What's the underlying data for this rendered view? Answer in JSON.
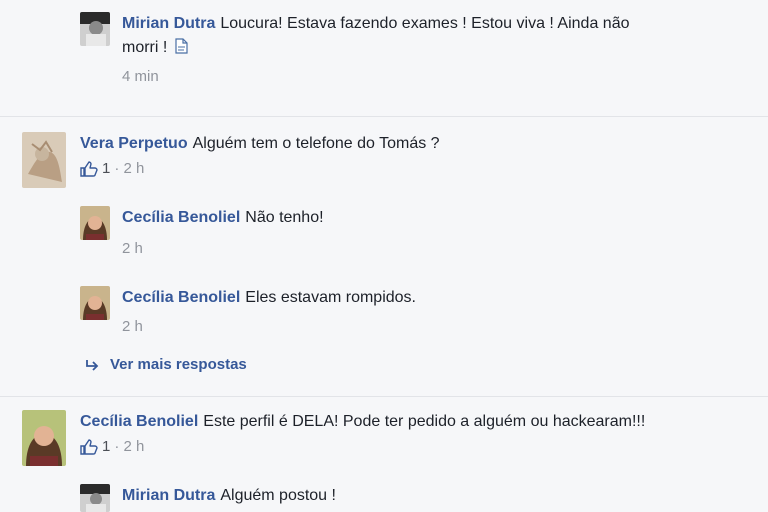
{
  "comments": [
    {
      "author": "Mirian Dutra",
      "text": "Loucura! Estava fazendo exames ! Estou viva ! Ainda não",
      "text_line2": "morri !",
      "time": "4 min"
    },
    {
      "author": "Vera Perpetuo",
      "text": "Alguém tem o telefone do Tomás ?",
      "likes": "1",
      "time": "· 2 h"
    },
    {
      "author": "Cecília Benoliel",
      "text": "Não tenho!",
      "time": "2 h"
    },
    {
      "author": "Cecília Benoliel",
      "text": "Eles estavam rompidos.",
      "time": "2 h"
    },
    {
      "author": "Cecília Benoliel",
      "text": "Este perfil é DELA! Pode ter pedido a alguém ou hackearam!!!",
      "likes": "1",
      "time": "· 2 h"
    },
    {
      "author": "Mirian Dutra",
      "text": "Alguém postou !"
    }
  ],
  "more_replies": "Ver mais respostas",
  "icons": {
    "like": "thumbs-up-icon",
    "reply": "reply-arrow-icon",
    "emoji": "document-emoji-icon"
  },
  "colors": {
    "author": "#365899",
    "meta": "#90949c",
    "background": "#f6f7f9"
  }
}
